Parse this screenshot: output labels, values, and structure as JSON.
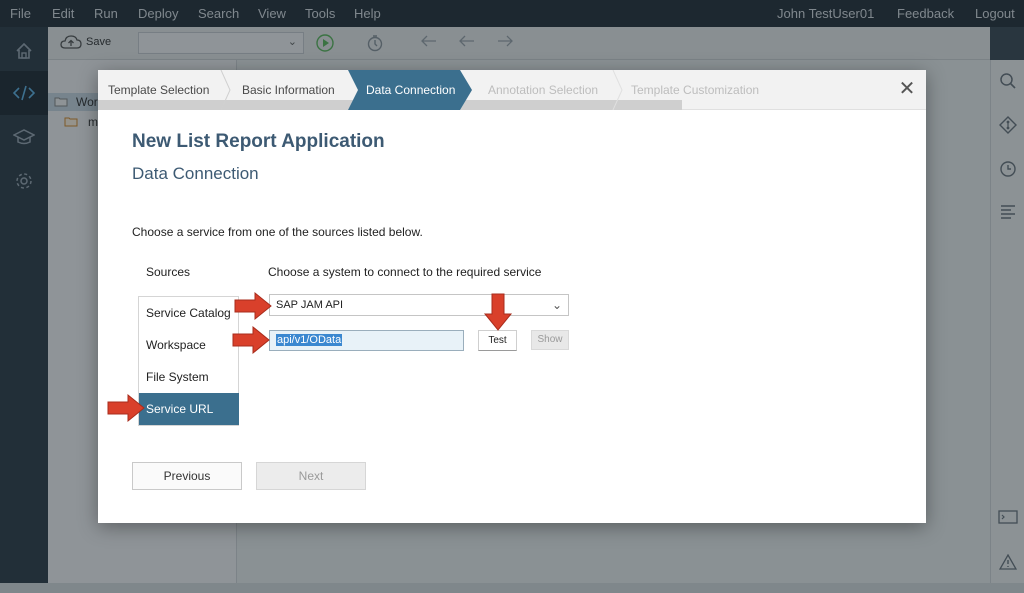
{
  "menubar": {
    "items": [
      "File",
      "Edit",
      "Run",
      "Deploy",
      "Search",
      "View",
      "Tools",
      "Help"
    ],
    "user": "John TestUser01",
    "feedback": "Feedback",
    "logout": "Logout"
  },
  "toolbar": {
    "save_label": "Save"
  },
  "tree": {
    "root_label": "Wor",
    "child_label": "m"
  },
  "dialog": {
    "steps": [
      "Template Selection",
      "Basic Information",
      "Data Connection",
      "Annotation Selection",
      "Template Customization"
    ],
    "active_step": "Data Connection",
    "title": "New List Report Application",
    "subtitle": "Data Connection",
    "instruction": "Choose a service from one of the sources listed below.",
    "sources_header": "Sources",
    "choose_header": "Choose a system to connect to the required service",
    "sources": [
      "Service Catalog",
      "Workspace",
      "File System",
      "Service URL"
    ],
    "selected_source": "Service URL",
    "system_value": "SAP JAM API",
    "url_value": "api/v1/OData",
    "test_label": "Test",
    "show_label": "Show",
    "previous_label": "Previous",
    "next_label": "Next"
  },
  "icons": {
    "left_nav": [
      "home-icon",
      "code-icon",
      "graduation-cap-icon",
      "gear-icon"
    ],
    "right_bar": [
      "search-icon",
      "git-icon",
      "history-icon",
      "outline-icon",
      "console-icon",
      "warning-icon"
    ],
    "annotation_color": "#d9402b"
  }
}
